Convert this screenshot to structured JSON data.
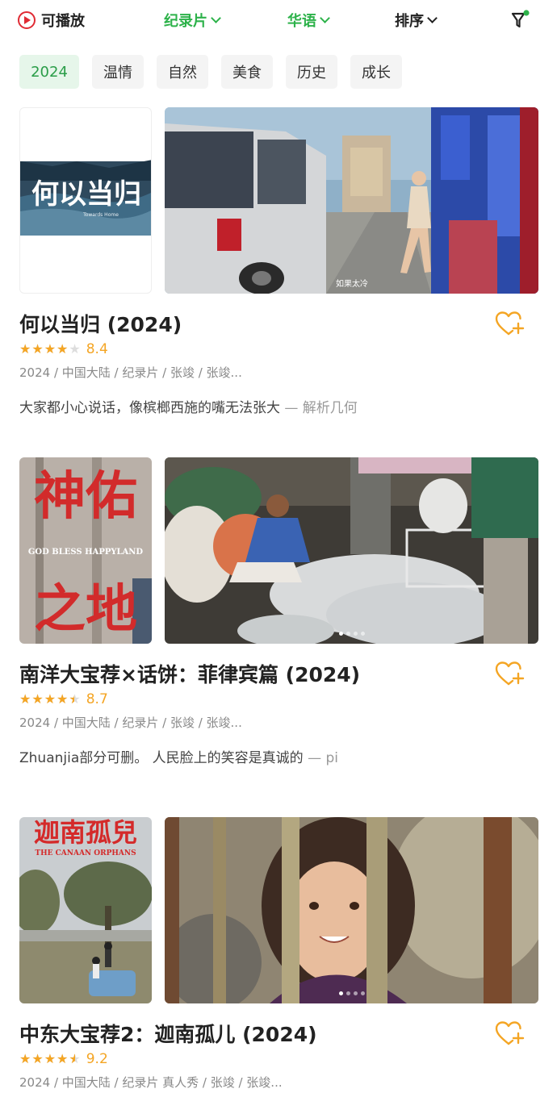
{
  "topbar": {
    "playable_label": "可播放",
    "genre_label": "纪录片",
    "language_label": "华语",
    "sort_label": "排序"
  },
  "chips": [
    "2024",
    "温情",
    "自然",
    "美食",
    "历史",
    "成长"
  ],
  "cards": [
    {
      "title": "何以当归 (2024)",
      "rating": "8.4",
      "rating_fraction": 0.84,
      "meta": "2024 / 中国大陆 / 纪录片 / 张竣 / 张竣...",
      "review": "大家都小心说话，像槟榔西施的嘴无法张大",
      "review_source": "— 解析几何",
      "poster_text": "何以当归",
      "poster_sub": "Towards Home",
      "still_caption": "如果太冷"
    },
    {
      "title": "南洋大宝荐×话饼：菲律宾篇 (2024)",
      "rating": "8.7",
      "rating_fraction": 0.87,
      "meta": "2024 / 中国大陆 / 纪录片 / 张竣 / 张竣...",
      "review": "Zhuanjia部分可删。 人民脸上的笑容是真诚的",
      "review_source": "— pi",
      "poster_text_top": "神佑",
      "poster_text_bottom": "之地",
      "poster_sub": "GOD BLESS HAPPYLAND"
    },
    {
      "title": "中东大宝荐2：迦南孤儿 (2024)",
      "rating": "9.2",
      "rating_fraction": 0.92,
      "meta": "2024 / 中国大陆 / 纪录片 真人秀 / 张竣 / 张竣...",
      "poster_text": "迦南孤兒",
      "poster_sub": "THE CANAAN ORPHANS"
    }
  ],
  "colors": {
    "accent_green": "#2db24a",
    "star_orange": "#f4a524",
    "play_red": "#e02b34"
  }
}
